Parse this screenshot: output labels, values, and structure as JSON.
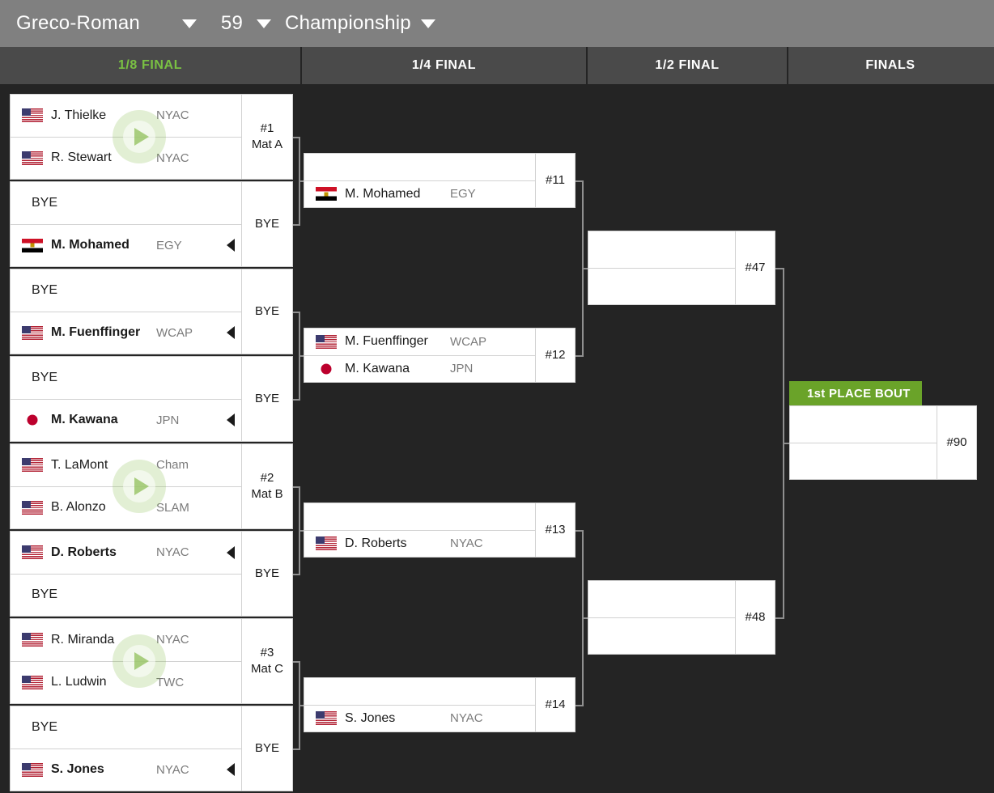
{
  "topbar": {
    "style": "Greco-Roman",
    "weight": "59",
    "level": "Championship",
    "caret_icon": "chevron-down-icon"
  },
  "rounds": [
    {
      "label": "1/8 FINAL",
      "active": true
    },
    {
      "label": "1/4 FINAL",
      "active": false
    },
    {
      "label": "1/2 FINAL",
      "active": false
    },
    {
      "label": "FINALS",
      "active": false
    }
  ],
  "colors": {
    "accent_green": "#7ac143",
    "banner_green": "#6aa329",
    "topbar_gray": "#808080",
    "roundbar_gray": "#4a4a4a",
    "background": "#242424",
    "box_white": "#ffffff",
    "club_text": "#7b7b7b"
  },
  "round16": [
    {
      "bout": "#1",
      "mat": "Mat A",
      "has_video": true,
      "top": {
        "name": "J. Thielke",
        "club": "NYAC",
        "flag": "usa",
        "winner": false
      },
      "bottom": {
        "name": "R. Stewart",
        "club": "NYAC",
        "flag": "usa",
        "winner": false
      }
    },
    {
      "bout": "BYE",
      "mat": "",
      "has_video": false,
      "top": {
        "name": "BYE",
        "club": "",
        "flag": "none",
        "winner": false
      },
      "bottom": {
        "name": "M. Mohamed",
        "club": "EGY",
        "flag": "egy",
        "winner": true
      }
    },
    {
      "bout": "BYE",
      "mat": "",
      "has_video": false,
      "top": {
        "name": "BYE",
        "club": "",
        "flag": "none",
        "winner": false
      },
      "bottom": {
        "name": "M. Fuenffinger",
        "club": "WCAP",
        "flag": "usa",
        "winner": true
      }
    },
    {
      "bout": "BYE",
      "mat": "",
      "has_video": false,
      "top": {
        "name": "BYE",
        "club": "",
        "flag": "none",
        "winner": false
      },
      "bottom": {
        "name": "M. Kawana",
        "club": "JPN",
        "flag": "jpn",
        "winner": true
      }
    },
    {
      "bout": "#2",
      "mat": "Mat B",
      "has_video": true,
      "top": {
        "name": "T. LaMont",
        "club": "Cham",
        "flag": "usa",
        "winner": false
      },
      "bottom": {
        "name": "B. Alonzo",
        "club": "SLAM",
        "flag": "usa",
        "winner": false
      }
    },
    {
      "bout": "BYE",
      "mat": "",
      "has_video": false,
      "top": {
        "name": "D. Roberts",
        "club": "NYAC",
        "flag": "usa",
        "winner": true
      },
      "bottom": {
        "name": "BYE",
        "club": "",
        "flag": "none",
        "winner": false
      }
    },
    {
      "bout": "#3",
      "mat": "Mat C",
      "has_video": true,
      "top": {
        "name": "R. Miranda",
        "club": "NYAC",
        "flag": "usa",
        "winner": false
      },
      "bottom": {
        "name": "L. Ludwin",
        "club": "TWC",
        "flag": "usa",
        "winner": false
      }
    },
    {
      "bout": "BYE",
      "mat": "",
      "has_video": false,
      "top": {
        "name": "BYE",
        "club": "",
        "flag": "none",
        "winner": false
      },
      "bottom": {
        "name": "S. Jones",
        "club": "NYAC",
        "flag": "usa",
        "winner": true
      }
    }
  ],
  "quarterfinals": [
    {
      "bout": "#11",
      "top": {
        "name": "",
        "club": "",
        "flag": "none",
        "winner": false
      },
      "bottom": {
        "name": "M. Mohamed",
        "club": "EGY",
        "flag": "egy",
        "winner": false
      }
    },
    {
      "bout": "#12",
      "top": {
        "name": "M. Fuenffinger",
        "club": "WCAP",
        "flag": "usa",
        "winner": false
      },
      "bottom": {
        "name": "M. Kawana",
        "club": "JPN",
        "flag": "jpn",
        "winner": false
      }
    },
    {
      "bout": "#13",
      "top": {
        "name": "",
        "club": "",
        "flag": "none",
        "winner": false
      },
      "bottom": {
        "name": "D. Roberts",
        "club": "NYAC",
        "flag": "usa",
        "winner": false
      }
    },
    {
      "bout": "#14",
      "top": {
        "name": "",
        "club": "",
        "flag": "none",
        "winner": false
      },
      "bottom": {
        "name": "S. Jones",
        "club": "NYAC",
        "flag": "usa",
        "winner": false
      }
    }
  ],
  "semifinals": [
    {
      "bout": "#47",
      "top": {
        "name": "",
        "club": "",
        "flag": "none",
        "winner": false
      },
      "bottom": {
        "name": "",
        "club": "",
        "flag": "none",
        "winner": false
      }
    },
    {
      "bout": "#48",
      "top": {
        "name": "",
        "club": "",
        "flag": "none",
        "winner": false
      },
      "bottom": {
        "name": "",
        "club": "",
        "flag": "none",
        "winner": false
      }
    }
  ],
  "finals": {
    "banner": "1st PLACE BOUT",
    "bout": "#90",
    "top": {
      "name": "",
      "club": "",
      "flag": "none",
      "winner": false
    },
    "bottom": {
      "name": "",
      "club": "",
      "flag": "none",
      "winner": false
    }
  }
}
